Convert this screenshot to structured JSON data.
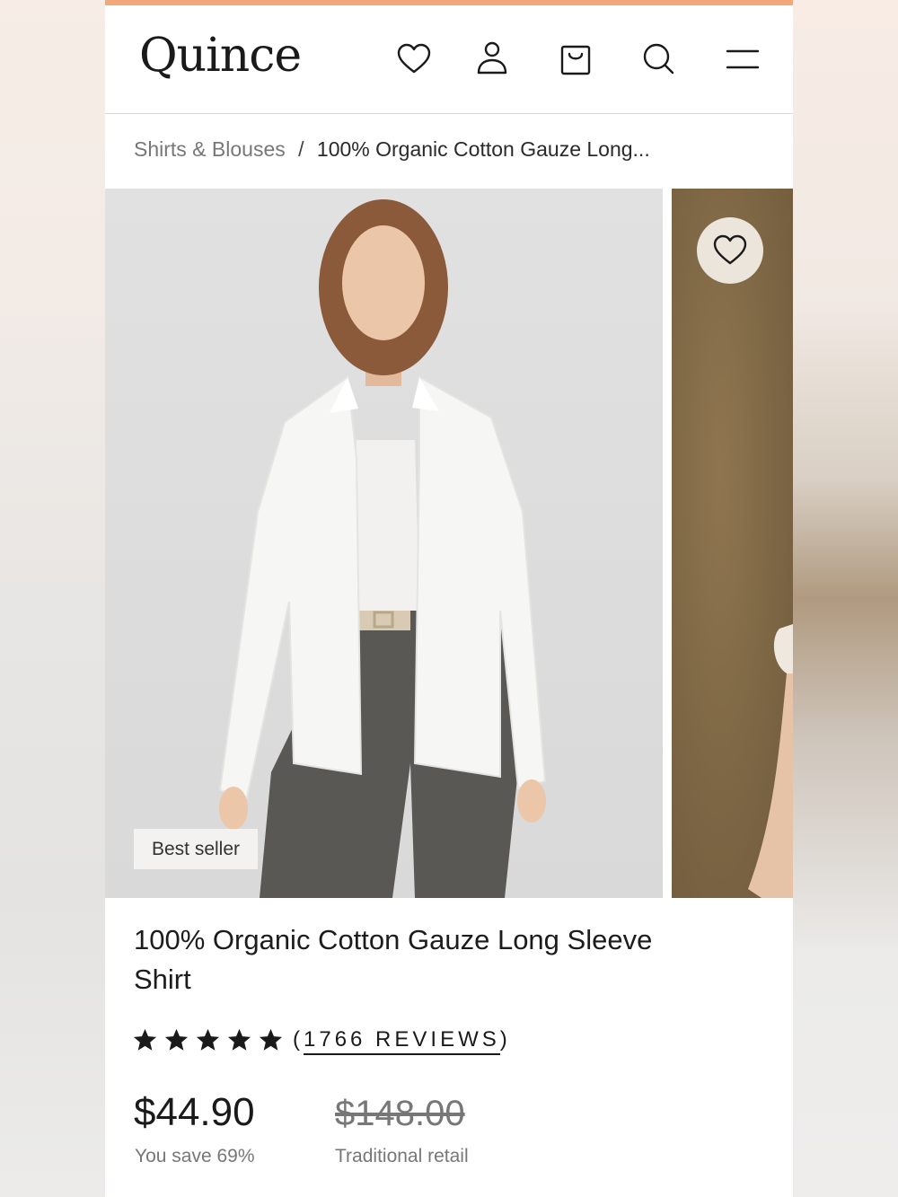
{
  "brand": {
    "logo_text": "Quince"
  },
  "header": {
    "icons": [
      "heart-icon",
      "account-icon",
      "shopping-bag-icon",
      "search-icon",
      "menu-icon"
    ]
  },
  "breadcrumb": {
    "parent": "Shirts & Blouses",
    "separator": "/",
    "current": "100% Organic Cotton Gauze Long..."
  },
  "gallery": {
    "badge": "Best seller",
    "wishlist_icon": "heart-icon"
  },
  "product": {
    "title": "100% Organic Cotton Gauze Long Sleeve Shirt",
    "rating": {
      "stars": 5,
      "max": 5,
      "reviews_open": "(",
      "reviews_text": "1766 REVIEWS",
      "reviews_close": ")"
    },
    "price": "$44.90",
    "savings": "You save 69%",
    "retail_price": "$148.00",
    "retail_label": "Traditional retail"
  },
  "colors": {
    "accent_bar": "#f3a87a",
    "text": "#1a1a1a",
    "muted": "#777777"
  }
}
